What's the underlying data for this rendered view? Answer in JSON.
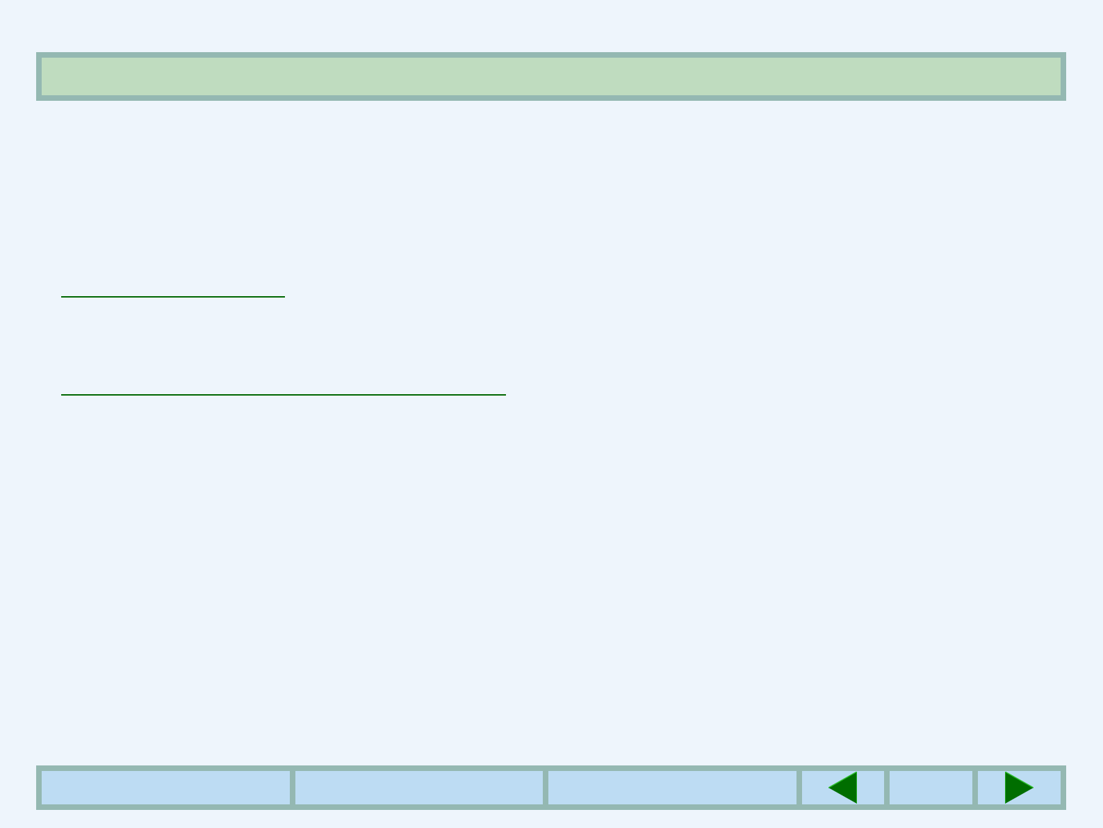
{
  "links": [
    {
      "kind": "short"
    },
    {
      "kind": "long"
    }
  ],
  "footer": {
    "cells": [
      {
        "kind": "blank"
      },
      {
        "kind": "blank"
      },
      {
        "kind": "blank"
      },
      {
        "kind": "previous"
      },
      {
        "kind": "blank"
      },
      {
        "kind": "next"
      }
    ]
  }
}
